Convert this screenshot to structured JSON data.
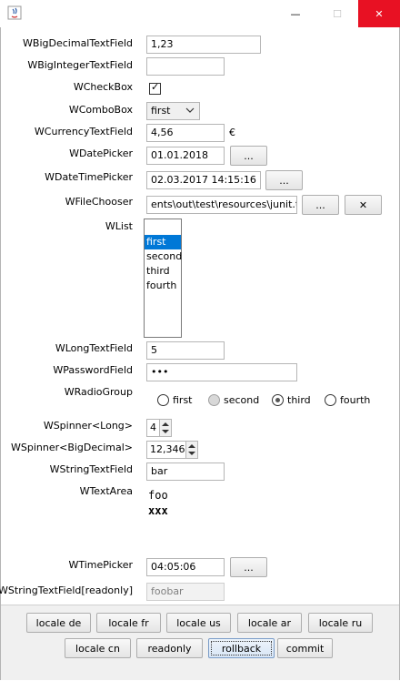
{
  "window": {
    "min_glyph": "—",
    "max_glyph": "☐",
    "close_glyph": "✕"
  },
  "labels": {
    "big_decimal": "WBigDecimalTextField",
    "big_integer": "WBigIntegerTextField",
    "checkbox": "WCheckBox",
    "combobox": "WComboBox",
    "currency": "WCurrencyTextField",
    "date_picker": "WDatePicker",
    "datetime_picker": "WDateTimePicker",
    "file_chooser": "WFileChooser",
    "list": "WList",
    "long_field": "WLongTextField",
    "password": "WPasswordField",
    "radio_group": "WRadioGroup",
    "spinner_long": "WSpinner<Long>",
    "spinner_bigdecimal": "WSpinner<BigDecimal>",
    "string_field": "WStringTextField",
    "textarea": "WTextArea",
    "time_picker": "WTimePicker",
    "string_readonly": "WStringTextField[readonly]"
  },
  "values": {
    "big_decimal": "1,23",
    "big_integer": "",
    "checkbox_mark": "✓",
    "combobox": "first",
    "currency": "4,56",
    "currency_symbol": "€",
    "date": "01.01.2018",
    "datetime": "02.03.2017 14:15:16",
    "file_path": "ents\\out\\test\\resources\\junit.txt",
    "long": "5",
    "password": "•••",
    "spinner_long": "4",
    "spinner_bigdecimal": "12,346",
    "string": "bar",
    "textarea_line1": "foo",
    "textarea_line2": "xxx",
    "time": "04:05:06",
    "string_readonly": "foobar"
  },
  "list_items": [
    "first",
    "second",
    "third",
    "fourth"
  ],
  "radio_options": [
    "first",
    "second",
    "third",
    "fourth"
  ],
  "browse_label": "...",
  "clear_glyph": "✕",
  "buttons": {
    "locale_de": "locale de",
    "locale_fr": "locale fr",
    "locale_us": "locale us",
    "locale_ar": "locale ar",
    "locale_ru": "locale ru",
    "locale_cn": "locale cn",
    "readonly": "readonly",
    "rollback": "rollback",
    "commit": "commit"
  },
  "colors": {
    "close_red": "#e81123",
    "selection_blue": "#0078d7"
  }
}
